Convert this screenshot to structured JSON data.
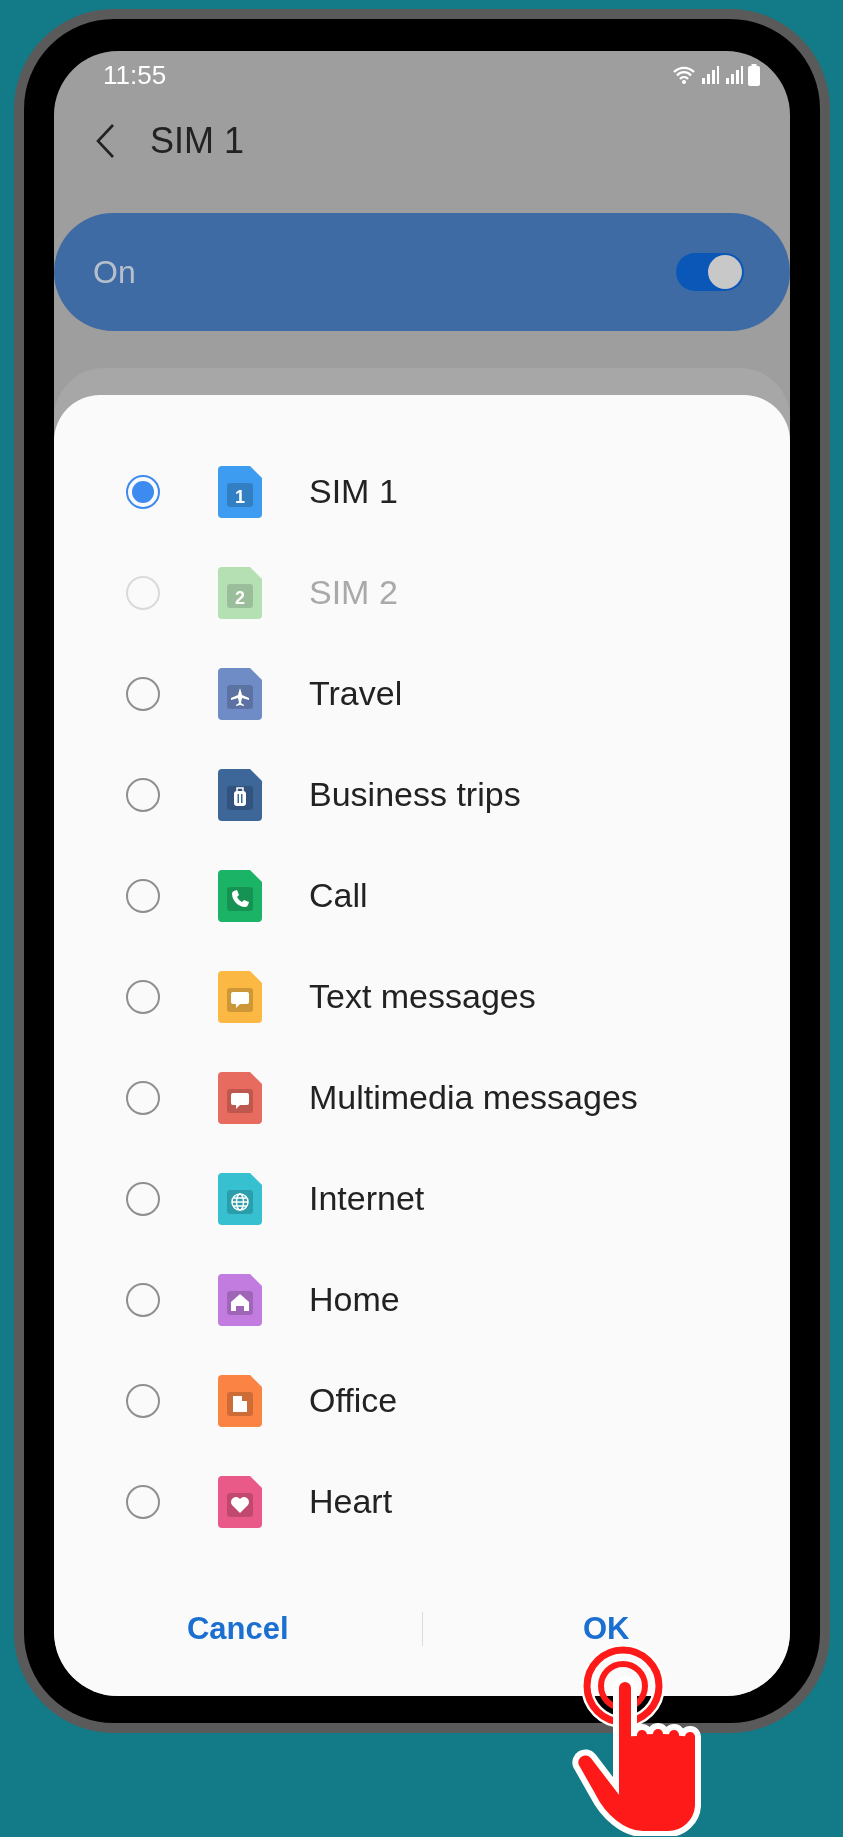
{
  "status_bar": {
    "time": "11:55"
  },
  "header": {
    "title": "SIM 1"
  },
  "switch_bar": {
    "label": "On",
    "on": true
  },
  "dialog": {
    "items": [
      {
        "label": "SIM 1",
        "selected": true,
        "disabled": false,
        "kind": "number",
        "badge": "1",
        "color": "#3d9bf0"
      },
      {
        "label": "SIM 2",
        "selected": false,
        "disabled": true,
        "kind": "number",
        "badge": "2",
        "color": "#a8dca8"
      },
      {
        "label": "Travel",
        "selected": false,
        "disabled": false,
        "kind": "plane",
        "color": "#6f8cc6"
      },
      {
        "label": "Business trips",
        "selected": false,
        "disabled": false,
        "kind": "luggage",
        "color": "#3d6699"
      },
      {
        "label": "Call",
        "selected": false,
        "disabled": false,
        "kind": "phone",
        "color": "#1bb466"
      },
      {
        "label": "Text messages",
        "selected": false,
        "disabled": false,
        "kind": "chat",
        "color": "#fbb944"
      },
      {
        "label": "Multimedia messages",
        "selected": false,
        "disabled": false,
        "kind": "chat",
        "color": "#e86b5f"
      },
      {
        "label": "Internet",
        "selected": false,
        "disabled": false,
        "kind": "globe",
        "color": "#36c0d0"
      },
      {
        "label": "Home",
        "selected": false,
        "disabled": false,
        "kind": "house",
        "color": "#c27ce0"
      },
      {
        "label": "Office",
        "selected": false,
        "disabled": false,
        "kind": "building",
        "color": "#fb8444"
      },
      {
        "label": "Heart",
        "selected": false,
        "disabled": false,
        "kind": "heart",
        "color": "#ea5a88"
      }
    ],
    "buttons": [
      "Cancel",
      "OK"
    ]
  }
}
